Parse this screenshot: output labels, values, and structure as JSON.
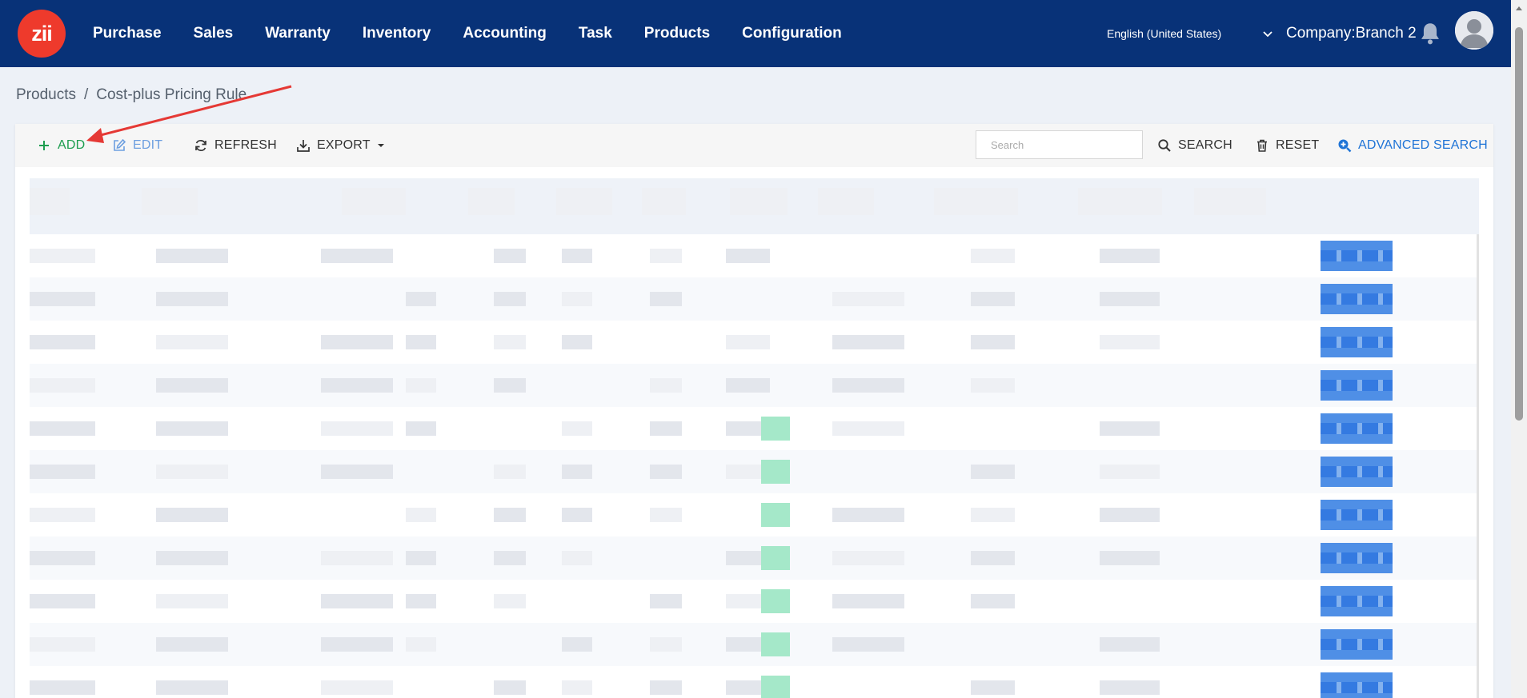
{
  "topbar": {
    "logo_text": "zii",
    "nav": [
      "Purchase",
      "Sales",
      "Warranty",
      "Inventory",
      "Accounting",
      "Task",
      "Products",
      "Configuration"
    ],
    "language": "English (United States)",
    "company": "Company:Branch 2"
  },
  "breadcrumb": {
    "parent": "Products",
    "separator": "/",
    "current": "Cost-plus Pricing Rule"
  },
  "toolbar": {
    "add_label": "ADD",
    "edit_label": "EDIT",
    "refresh_label": "REFRESH",
    "export_label": "EXPORT",
    "search_placeholder": "Search",
    "search_label": "SEARCH",
    "reset_label": "RESET",
    "advanced_search_label": "ADVANCED SEARCH"
  },
  "colors": {
    "nav_bg": "#083278",
    "logo_red": "#ee3a2c",
    "add_green": "#1e9e50",
    "accent_blue": "#1f74d6",
    "annotation_arrow": "#e53935"
  },
  "icons": {
    "add": "plus-icon",
    "edit": "edit-icon",
    "refresh": "refresh-icon",
    "export": "download-icon",
    "search": "search-icon",
    "reset": "trash-icon",
    "advanced": "zoom-plus-icon",
    "notifications": "bell-icon",
    "language_dropdown": "chevron-down-icon"
  }
}
